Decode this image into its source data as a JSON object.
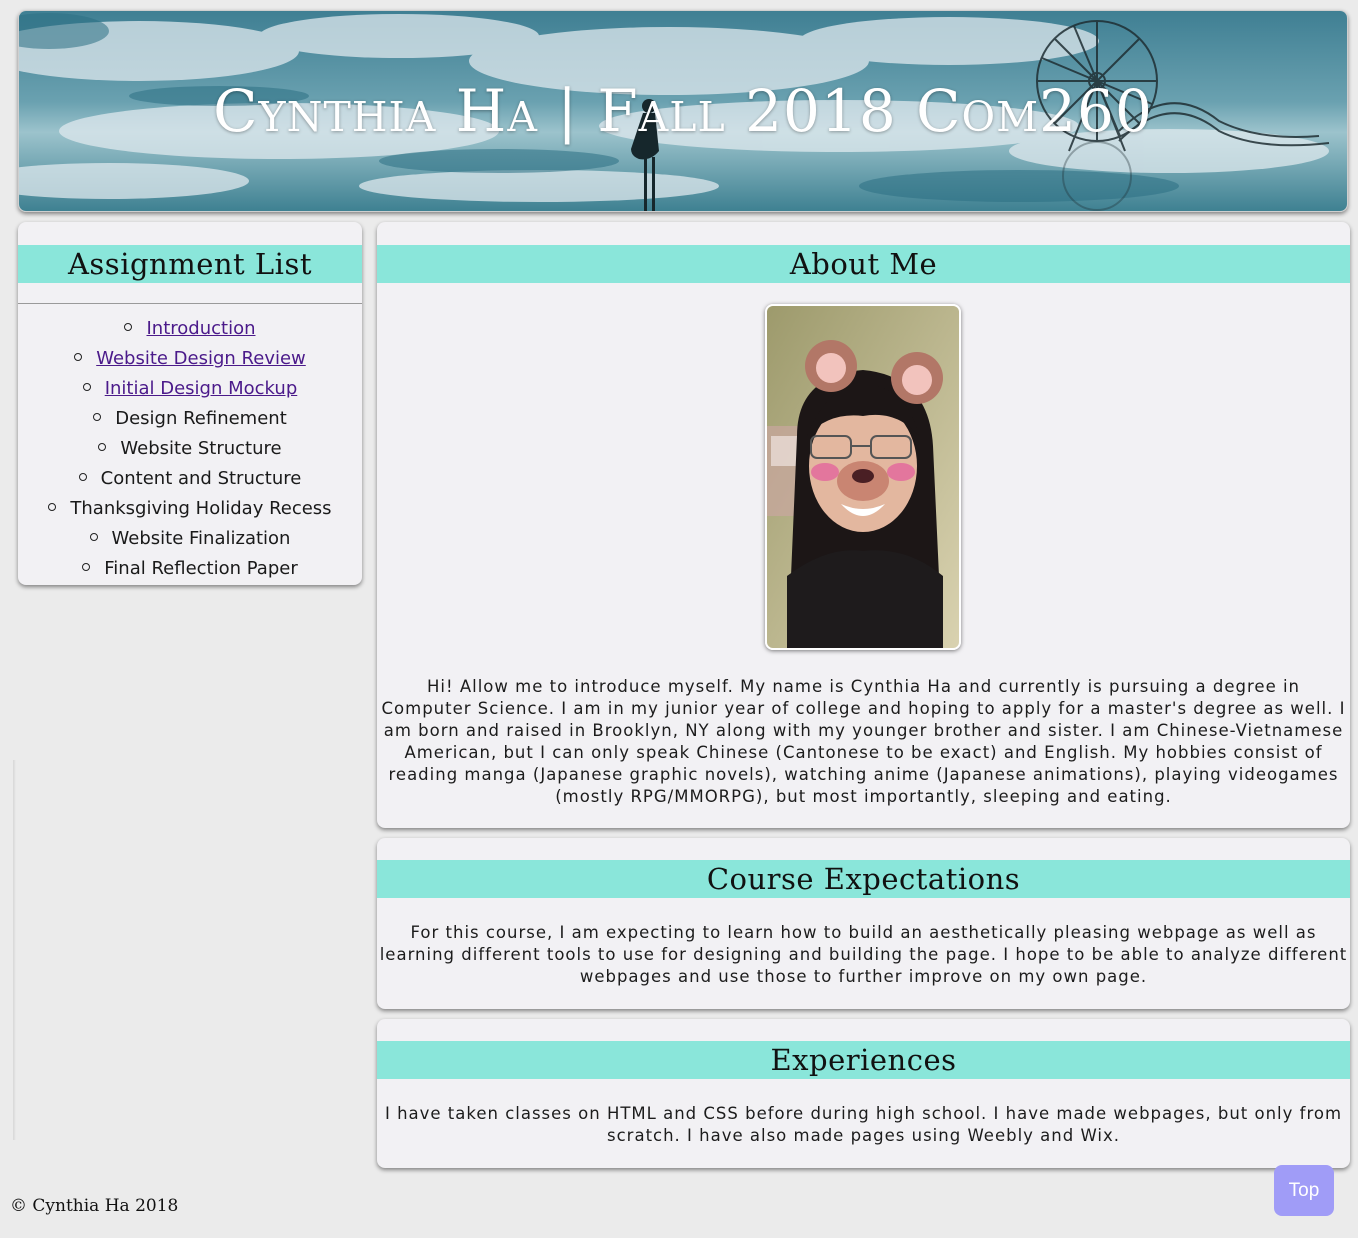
{
  "header": {
    "title": "Cynthia Ha | Fall 2018 Com260"
  },
  "sidebar": {
    "heading": "Assignment List",
    "items": [
      {
        "label": "Introduction",
        "link": true
      },
      {
        "label": "Website Design Review",
        "link": true
      },
      {
        "label": "Initial Design Mockup",
        "link": true
      },
      {
        "label": "Design Refinement",
        "link": false
      },
      {
        "label": "Website Structure",
        "link": false
      },
      {
        "label": "Content and Structure",
        "link": false
      },
      {
        "label": "Thanksgiving Holiday Recess",
        "link": false
      },
      {
        "label": "Website Finalization",
        "link": false
      },
      {
        "label": "Final Reflection Paper",
        "link": false
      }
    ]
  },
  "about": {
    "heading": "About Me",
    "text": "Hi! Allow me to introduce myself. My name is Cynthia Ha and currently is pursuing a degree in Computer Science. I am in my junior year of college and hoping to apply for a master's degree as well. I am born and raised in Brooklyn, NY along with my younger brother and sister. I am Chinese-Vietnamese American, but I can only speak Chinese (Cantonese to be exact) and English. My hobbies consist of reading manga (Japanese graphic novels), watching anime (Japanese animations), playing videogames (mostly RPG/MMORPG), but most importantly, sleeping and eating."
  },
  "expectations": {
    "heading": "Course Expectations",
    "text": "For this course, I am expecting to learn how to build an aesthetically pleasing webpage as well as learning different tools to use for designing and building the page. I hope to be able to analyze different webpages and use those to further improve on my own page."
  },
  "experiences": {
    "heading": "Experiences",
    "text": "I have taken classes on HTML and CSS before during high school. I have made webpages, but only from scratch. I have also made pages using Weebly and Wix."
  },
  "footer": {
    "copyright": "© Cynthia Ha 2018",
    "top_button": "Top"
  },
  "colors": {
    "heading_band": "#8ae6da",
    "panel_bg": "#f2f1f4",
    "page_bg": "#ebebeb",
    "link": "#4b1a8a",
    "top_button": "#a09cf7"
  }
}
